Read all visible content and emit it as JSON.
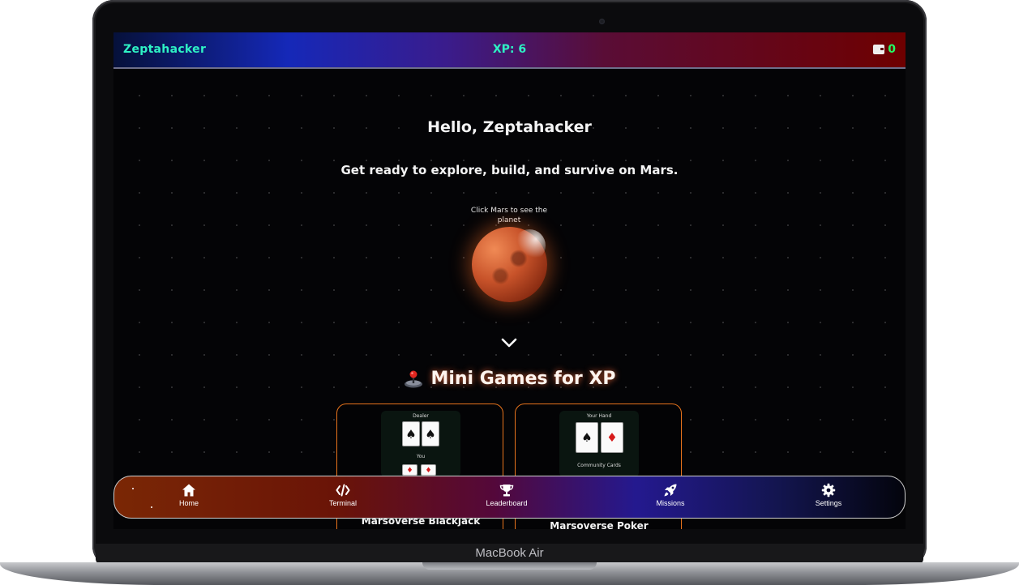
{
  "device": {
    "model_label": "MacBook Air"
  },
  "topbar": {
    "brand": "Zeptahacker",
    "xp": "XP: 6",
    "wallet_count": "0",
    "wallet_icon": "wallet-icon"
  },
  "hero": {
    "greeting": "Hello, Zeptahacker",
    "tagline": "Get ready to explore, build, and survive on Mars.",
    "mars_hint": "Click Mars to see the planet"
  },
  "minigames": {
    "title": "Mini Games for XP",
    "title_icon": "joystick-icon",
    "games": [
      {
        "name": "Marsoverse Blackjack",
        "preview_labels": [
          "Dealer",
          "You"
        ],
        "cards": [
          "♠",
          "♠",
          "♦",
          "♦"
        ]
      },
      {
        "name": "Marsoverse Poker",
        "preview_labels": [
          "Your Hand",
          "Community Cards"
        ],
        "cards": [
          "♠",
          "♦"
        ]
      }
    ]
  },
  "nav": {
    "items": [
      {
        "label": "Home",
        "icon": "home-icon"
      },
      {
        "label": "Terminal",
        "icon": "code-icon"
      },
      {
        "label": "Leaderboard",
        "icon": "trophy-icon"
      },
      {
        "label": "Missions",
        "icon": "rocket-icon"
      },
      {
        "label": "Settings",
        "icon": "gear-icon"
      }
    ]
  },
  "colors": {
    "accent_cyan": "#2ef2c4",
    "wallet_green": "#22ff66",
    "card_border": "#e8741c",
    "title_glow": "#ff6e3c"
  }
}
